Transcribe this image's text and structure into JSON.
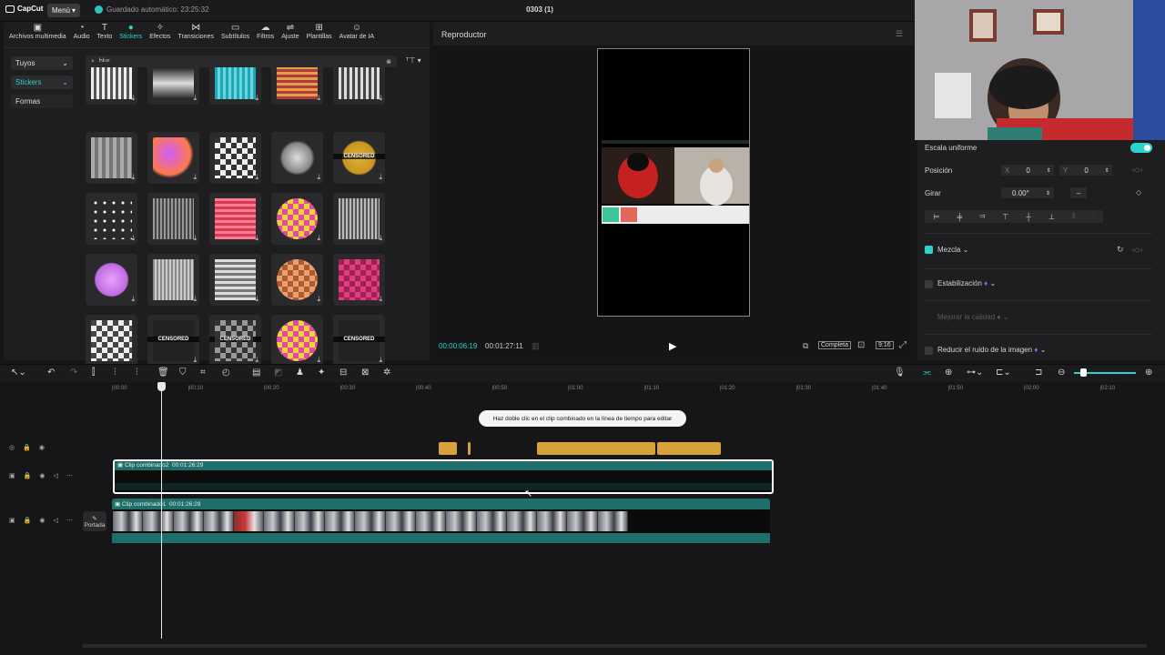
{
  "app": {
    "logo": "CapCut",
    "menu_label": "Menú",
    "autosave": "Guardado automático: 23:25:32",
    "project_title": "0303 (1)"
  },
  "toolbar": {
    "items": [
      {
        "label": "Archivos multimedia",
        "icon": "media-icon"
      },
      {
        "label": "Audio",
        "icon": "audio-icon"
      },
      {
        "label": "Texto",
        "icon": "text-icon"
      },
      {
        "label": "Stickers",
        "icon": "stickers-icon",
        "active": true
      },
      {
        "label": "Efectos",
        "icon": "effects-icon"
      },
      {
        "label": "Transiciones",
        "icon": "transitions-icon"
      },
      {
        "label": "Subtítulos",
        "icon": "subtitles-icon"
      },
      {
        "label": "Filtros",
        "icon": "filters-icon"
      },
      {
        "label": "Ajuste",
        "icon": "adjust-icon"
      },
      {
        "label": "Plantillas",
        "icon": "templates-icon"
      },
      {
        "label": "Avatar de IA",
        "icon": "ai-avatar-icon"
      }
    ]
  },
  "sidebar": {
    "items": [
      {
        "label": "Tuyos"
      },
      {
        "label": "Stickers",
        "active": true
      },
      {
        "label": "Formas"
      }
    ]
  },
  "search": {
    "value": "blur"
  },
  "stickers": {
    "cards": [
      {
        "label": ""
      },
      {
        "label": ""
      },
      {
        "label": ""
      },
      {
        "label": ""
      },
      {
        "label": ""
      },
      {
        "label": ""
      },
      {
        "label": ""
      },
      {
        "label": ""
      },
      {
        "label": ""
      },
      {
        "label": "CENSORED"
      },
      {
        "label": ""
      },
      {
        "label": ""
      },
      {
        "label": ""
      },
      {
        "label": ""
      },
      {
        "label": ""
      },
      {
        "label": ""
      },
      {
        "label": ""
      },
      {
        "label": ""
      },
      {
        "label": ""
      },
      {
        "label": ""
      },
      {
        "label": ""
      },
      {
        "label": "CENSORED"
      },
      {
        "label": "CENSORED"
      },
      {
        "label": ""
      },
      {
        "label": "CENSORED"
      }
    ]
  },
  "player": {
    "title": "Reproductor",
    "current_time": "00:00:06:19",
    "total_time": "00:01:27:11",
    "quality": "Completa",
    "ratio": "9:16"
  },
  "properties": {
    "uniform_scale": "Escala uniforme",
    "position_label": "Posición",
    "x_label": "X",
    "x_value": "0",
    "y_label": "Y",
    "y_value": "0",
    "rotate_label": "Girar",
    "rotate_value": "0.00°",
    "rotate_reset": "–",
    "blend_label": "Mezcla",
    "stabilize_label": "Estabilización",
    "improve_quality_label": "Mejorar la calidad",
    "reduce_noise_label": "Reducir el ruido de la imagen"
  },
  "timeline": {
    "ruler_labels": [
      "00:00",
      "00:10",
      "00:20",
      "00:30",
      "00:40",
      "00:50",
      "01:00",
      "01:10",
      "01:20",
      "01:30",
      "01:40",
      "01:50",
      "02:00",
      "02:10"
    ],
    "hint": "Haz doble clic en el clip combinado en la línea de tiempo para editar",
    "clip_a": {
      "name": "Clip combinado2",
      "duration": "00:01:26:29"
    },
    "clip_b": {
      "name": "Clip combinado1",
      "duration": "00:01:26:29"
    },
    "cover_label": "Portada"
  },
  "colors": {
    "accent": "#2bd4ca",
    "sticker_track": "#d6a23a",
    "clip_teal": "#1e6e69"
  }
}
